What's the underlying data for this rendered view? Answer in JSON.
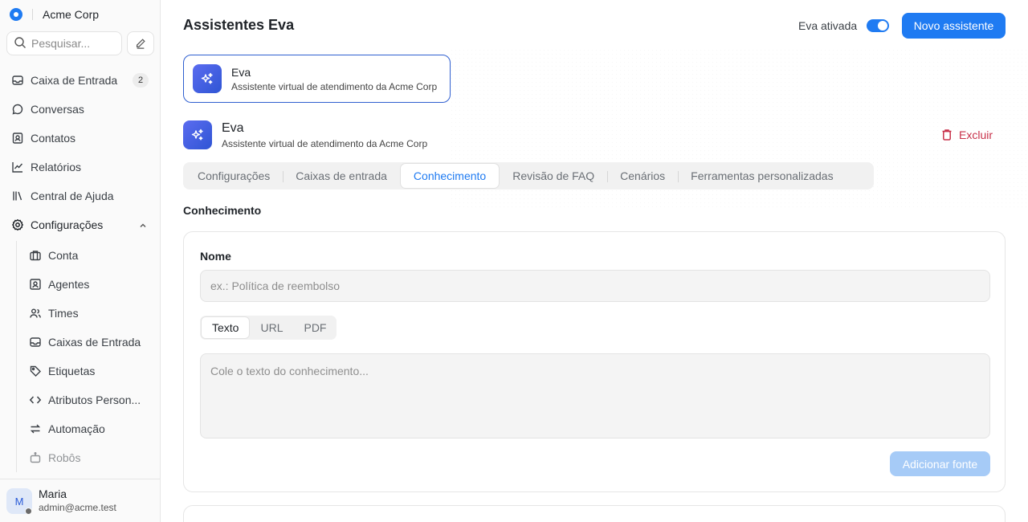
{
  "sidebar": {
    "org_name": "Acme Corp",
    "search_placeholder": "Pesquisar...",
    "nav": [
      {
        "label": "Caixa de Entrada",
        "icon": "inbox-icon",
        "badge": "2"
      },
      {
        "label": "Conversas",
        "icon": "chat-bubble-icon"
      },
      {
        "label": "Contatos",
        "icon": "contact-card-icon"
      },
      {
        "label": "Relatórios",
        "icon": "line-chart-icon"
      },
      {
        "label": "Central de Ajuda",
        "icon": "library-icon"
      },
      {
        "label": "Configurações",
        "icon": "gear-icon",
        "expanded": true
      }
    ],
    "settings_items": [
      {
        "label": "Conta",
        "icon": "briefcase-icon"
      },
      {
        "label": "Agentes",
        "icon": "user-square-icon"
      },
      {
        "label": "Times",
        "icon": "users-icon"
      },
      {
        "label": "Caixas de Entrada",
        "icon": "inbox-icon"
      },
      {
        "label": "Etiquetas",
        "icon": "tag-icon"
      },
      {
        "label": "Atributos Person...",
        "icon": "code-icon"
      },
      {
        "label": "Automação",
        "icon": "arrows-swap-icon"
      },
      {
        "label": "Robôs",
        "icon": "bot-icon"
      }
    ],
    "user": {
      "initial": "M",
      "name": "Maria",
      "email": "admin@acme.test"
    }
  },
  "header": {
    "title": "Assistentes Eva",
    "toggle_label": "Eva ativada",
    "toggle_on": true,
    "new_button": "Novo assistente"
  },
  "assistant_card": {
    "name": "Eva",
    "description": "Assistente virtual de atendimento da Acme Corp"
  },
  "detail": {
    "name": "Eva",
    "description": "Assistente virtual de atendimento da Acme Corp",
    "delete_label": "Excluir"
  },
  "tabs": [
    {
      "label": "Configurações"
    },
    {
      "label": "Caixas de entrada"
    },
    {
      "label": "Conhecimento",
      "active": true
    },
    {
      "label": "Revisão de FAQ"
    },
    {
      "label": "Cenários"
    },
    {
      "label": "Ferramentas personalizadas"
    }
  ],
  "knowledge": {
    "section_title": "Conhecimento",
    "name_label": "Nome",
    "name_placeholder": "ex.: Política de reembolso",
    "source_tabs": [
      {
        "label": "Texto",
        "active": true
      },
      {
        "label": "URL"
      },
      {
        "label": "PDF"
      }
    ],
    "text_placeholder": "Cole o texto do conhecimento...",
    "add_button": "Adicionar fonte"
  },
  "colors": {
    "accent": "#1f7bf2",
    "danger": "#c8314a",
    "card_border": "#2f5fd0"
  }
}
